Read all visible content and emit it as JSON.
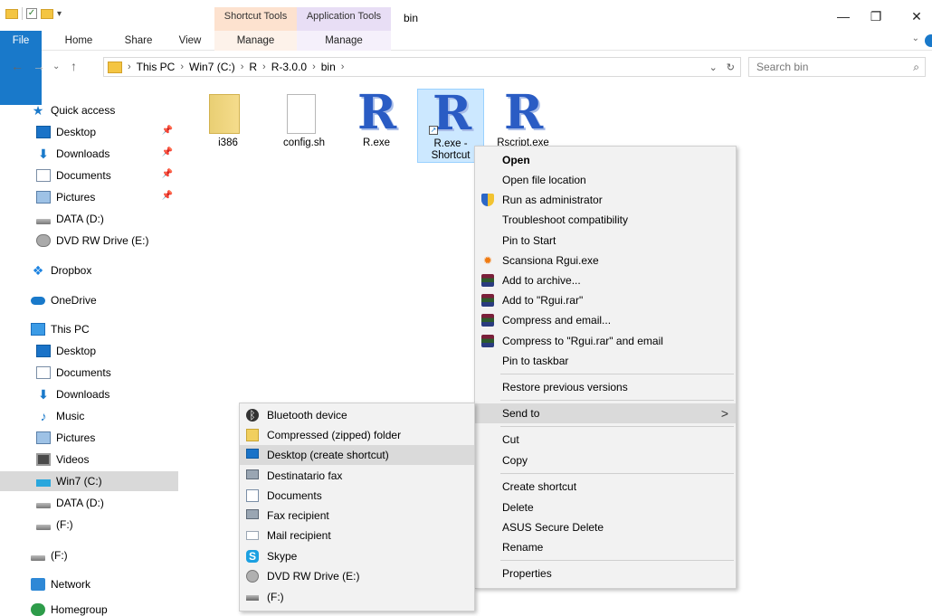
{
  "window": {
    "title": "bin",
    "contextual_tabs": [
      "Shortcut Tools",
      "Application Tools"
    ],
    "controls": {
      "minimize": "—",
      "restore": "❐",
      "close": "✕"
    }
  },
  "ribbon": {
    "tabs": [
      "File",
      "Home",
      "Share",
      "View",
      "Manage",
      "Manage"
    ],
    "accent": "#1979ca"
  },
  "address": {
    "crumbs": [
      "This PC",
      "Win7 (C:)",
      "R",
      "R-3.0.0",
      "bin"
    ],
    "search_placeholder": "Search bin"
  },
  "nav": {
    "items": [
      {
        "label": "Quick access",
        "icon": "star-icon"
      },
      {
        "label": "Desktop",
        "icon": "desktop-icon",
        "pinned": true
      },
      {
        "label": "Downloads",
        "icon": "download-icon",
        "pinned": true
      },
      {
        "label": "Documents",
        "icon": "documents-icon",
        "pinned": true
      },
      {
        "label": "Pictures",
        "icon": "pictures-icon",
        "pinned": true
      },
      {
        "label": "DATA (D:)",
        "icon": "drive-icon"
      },
      {
        "label": "DVD RW Drive (E:)",
        "icon": "dvd-icon"
      },
      {
        "label": "Dropbox",
        "icon": "dropbox-icon"
      },
      {
        "label": "OneDrive",
        "icon": "cloud-icon"
      },
      {
        "label": "This PC",
        "icon": "computer-icon"
      },
      {
        "label": "Desktop",
        "icon": "desktop-icon"
      },
      {
        "label": "Documents",
        "icon": "documents-icon"
      },
      {
        "label": "Downloads",
        "icon": "download-icon"
      },
      {
        "label": "Music",
        "icon": "music-icon"
      },
      {
        "label": "Pictures",
        "icon": "pictures-icon"
      },
      {
        "label": "Videos",
        "icon": "videos-icon"
      },
      {
        "label": "Win7 (C:)",
        "icon": "windows-drive-icon",
        "selected": true
      },
      {
        "label": "DATA (D:)",
        "icon": "drive-icon"
      },
      {
        "label": "(F:)",
        "icon": "drive-icon"
      },
      {
        "label": "(F:)",
        "icon": "drive-icon"
      },
      {
        "label": "Network",
        "icon": "network-icon"
      },
      {
        "label": "Homegroup",
        "icon": "homegroup-icon"
      }
    ]
  },
  "files": [
    {
      "name": "i386",
      "type": "folder"
    },
    {
      "name": "config.sh",
      "type": "file"
    },
    {
      "name": "R.exe",
      "type": "r-app"
    },
    {
      "name": "R.exe - Shortcut",
      "line1": "R.exe -",
      "line2": "Shortcut",
      "type": "r-shortcut",
      "selected": true
    },
    {
      "name": "Rscript.exe",
      "type": "r-app"
    }
  ],
  "context_menu": {
    "items": [
      {
        "label": "Open",
        "bold": true
      },
      {
        "label": "Open file location"
      },
      {
        "label": "Run as administrator",
        "icon": "shield-icon"
      },
      {
        "label": "Troubleshoot compatibility"
      },
      {
        "label": "Pin to Start"
      },
      {
        "label": "Scansiona Rgui.exe",
        "icon": "avast-icon"
      },
      {
        "label": "Add to archive...",
        "icon": "winrar-icon"
      },
      {
        "label": "Add to \"Rgui.rar\"",
        "icon": "winrar-icon"
      },
      {
        "label": "Compress and email...",
        "icon": "winrar-icon"
      },
      {
        "label": "Compress to \"Rgui.rar\" and email",
        "icon": "winrar-icon"
      },
      {
        "label": "Pin to taskbar"
      },
      {
        "label": "Restore previous versions"
      },
      {
        "label": "Send to",
        "submenu": true,
        "hover": true
      },
      {
        "label": "Cut"
      },
      {
        "label": "Copy"
      },
      {
        "label": "Create shortcut"
      },
      {
        "label": "Delete"
      },
      {
        "label": "ASUS Secure Delete"
      },
      {
        "label": "Rename"
      },
      {
        "label": "Properties"
      }
    ],
    "submenu_arrow": ">"
  },
  "send_to_menu": {
    "items": [
      {
        "label": "Bluetooth device",
        "icon": "bluetooth-icon"
      },
      {
        "label": "Compressed (zipped) folder",
        "icon": "zip-folder-icon"
      },
      {
        "label": "Desktop (create shortcut)",
        "icon": "desktop-icon",
        "hover": true
      },
      {
        "label": "Destinatario fax",
        "icon": "fax-icon"
      },
      {
        "label": "Documents",
        "icon": "documents-icon"
      },
      {
        "label": "Fax recipient",
        "icon": "fax-icon"
      },
      {
        "label": "Mail recipient",
        "icon": "mail-icon"
      },
      {
        "label": "Skype",
        "icon": "skype-icon"
      },
      {
        "label": "DVD RW Drive (E:)",
        "icon": "dvd-icon"
      },
      {
        "label": "(F:)",
        "icon": "drive-icon"
      }
    ]
  }
}
